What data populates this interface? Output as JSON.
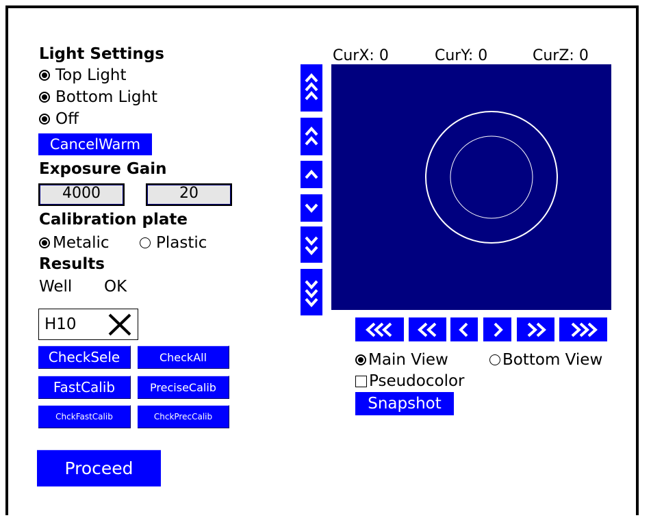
{
  "light": {
    "title": "Light Settings",
    "options": [
      "Top Light",
      "Bottom Light",
      "Off"
    ],
    "cancel_warm": "CancelWarm"
  },
  "exposure": {
    "title": "Exposure Gain",
    "exposure_value": "4000",
    "gain_value": "20"
  },
  "calibration": {
    "title": "Calibration plate",
    "options": [
      "Metalic",
      "Plastic"
    ],
    "selected": "Metalic"
  },
  "results": {
    "title": "Results",
    "col_well": "Well",
    "col_status": "OK",
    "well_value": "H10"
  },
  "buttons": {
    "check_sele": "CheckSele",
    "check_all": "CheckAll",
    "fast_calib": "FastCalib",
    "precise_calib": "PreciseCalib",
    "chck_fast_calib": "ChckFastCalib",
    "chck_prec_calib": "ChckPrecCalib",
    "proceed": "Proceed",
    "snapshot": "Snapshot"
  },
  "coords": {
    "x_label": "CurX:",
    "x_value": "0",
    "y_label": "CurY:",
    "y_value": "0",
    "z_label": "CurZ:",
    "z_value": "0"
  },
  "view": {
    "options": [
      "Main View",
      "Bottom View"
    ],
    "selected": "Main View",
    "pseudocolor_label": "Pseudocolor",
    "pseudocolor_checked": false
  },
  "colors": {
    "button_blue": "#0000ff",
    "viewport_navy": "#00007f",
    "field_gray": "#e6e6e6"
  },
  "icons": {
    "z_up": [
      "triple-chevron-up-icon",
      "double-chevron-up-icon",
      "chevron-up-icon"
    ],
    "z_down": [
      "chevron-down-icon",
      "double-chevron-down-icon",
      "triple-chevron-down-icon"
    ],
    "x_moves": [
      "triple-chevron-left-icon",
      "double-chevron-left-icon",
      "chevron-left-icon",
      "chevron-right-icon",
      "double-chevron-right-icon",
      "triple-chevron-right-icon"
    ]
  }
}
